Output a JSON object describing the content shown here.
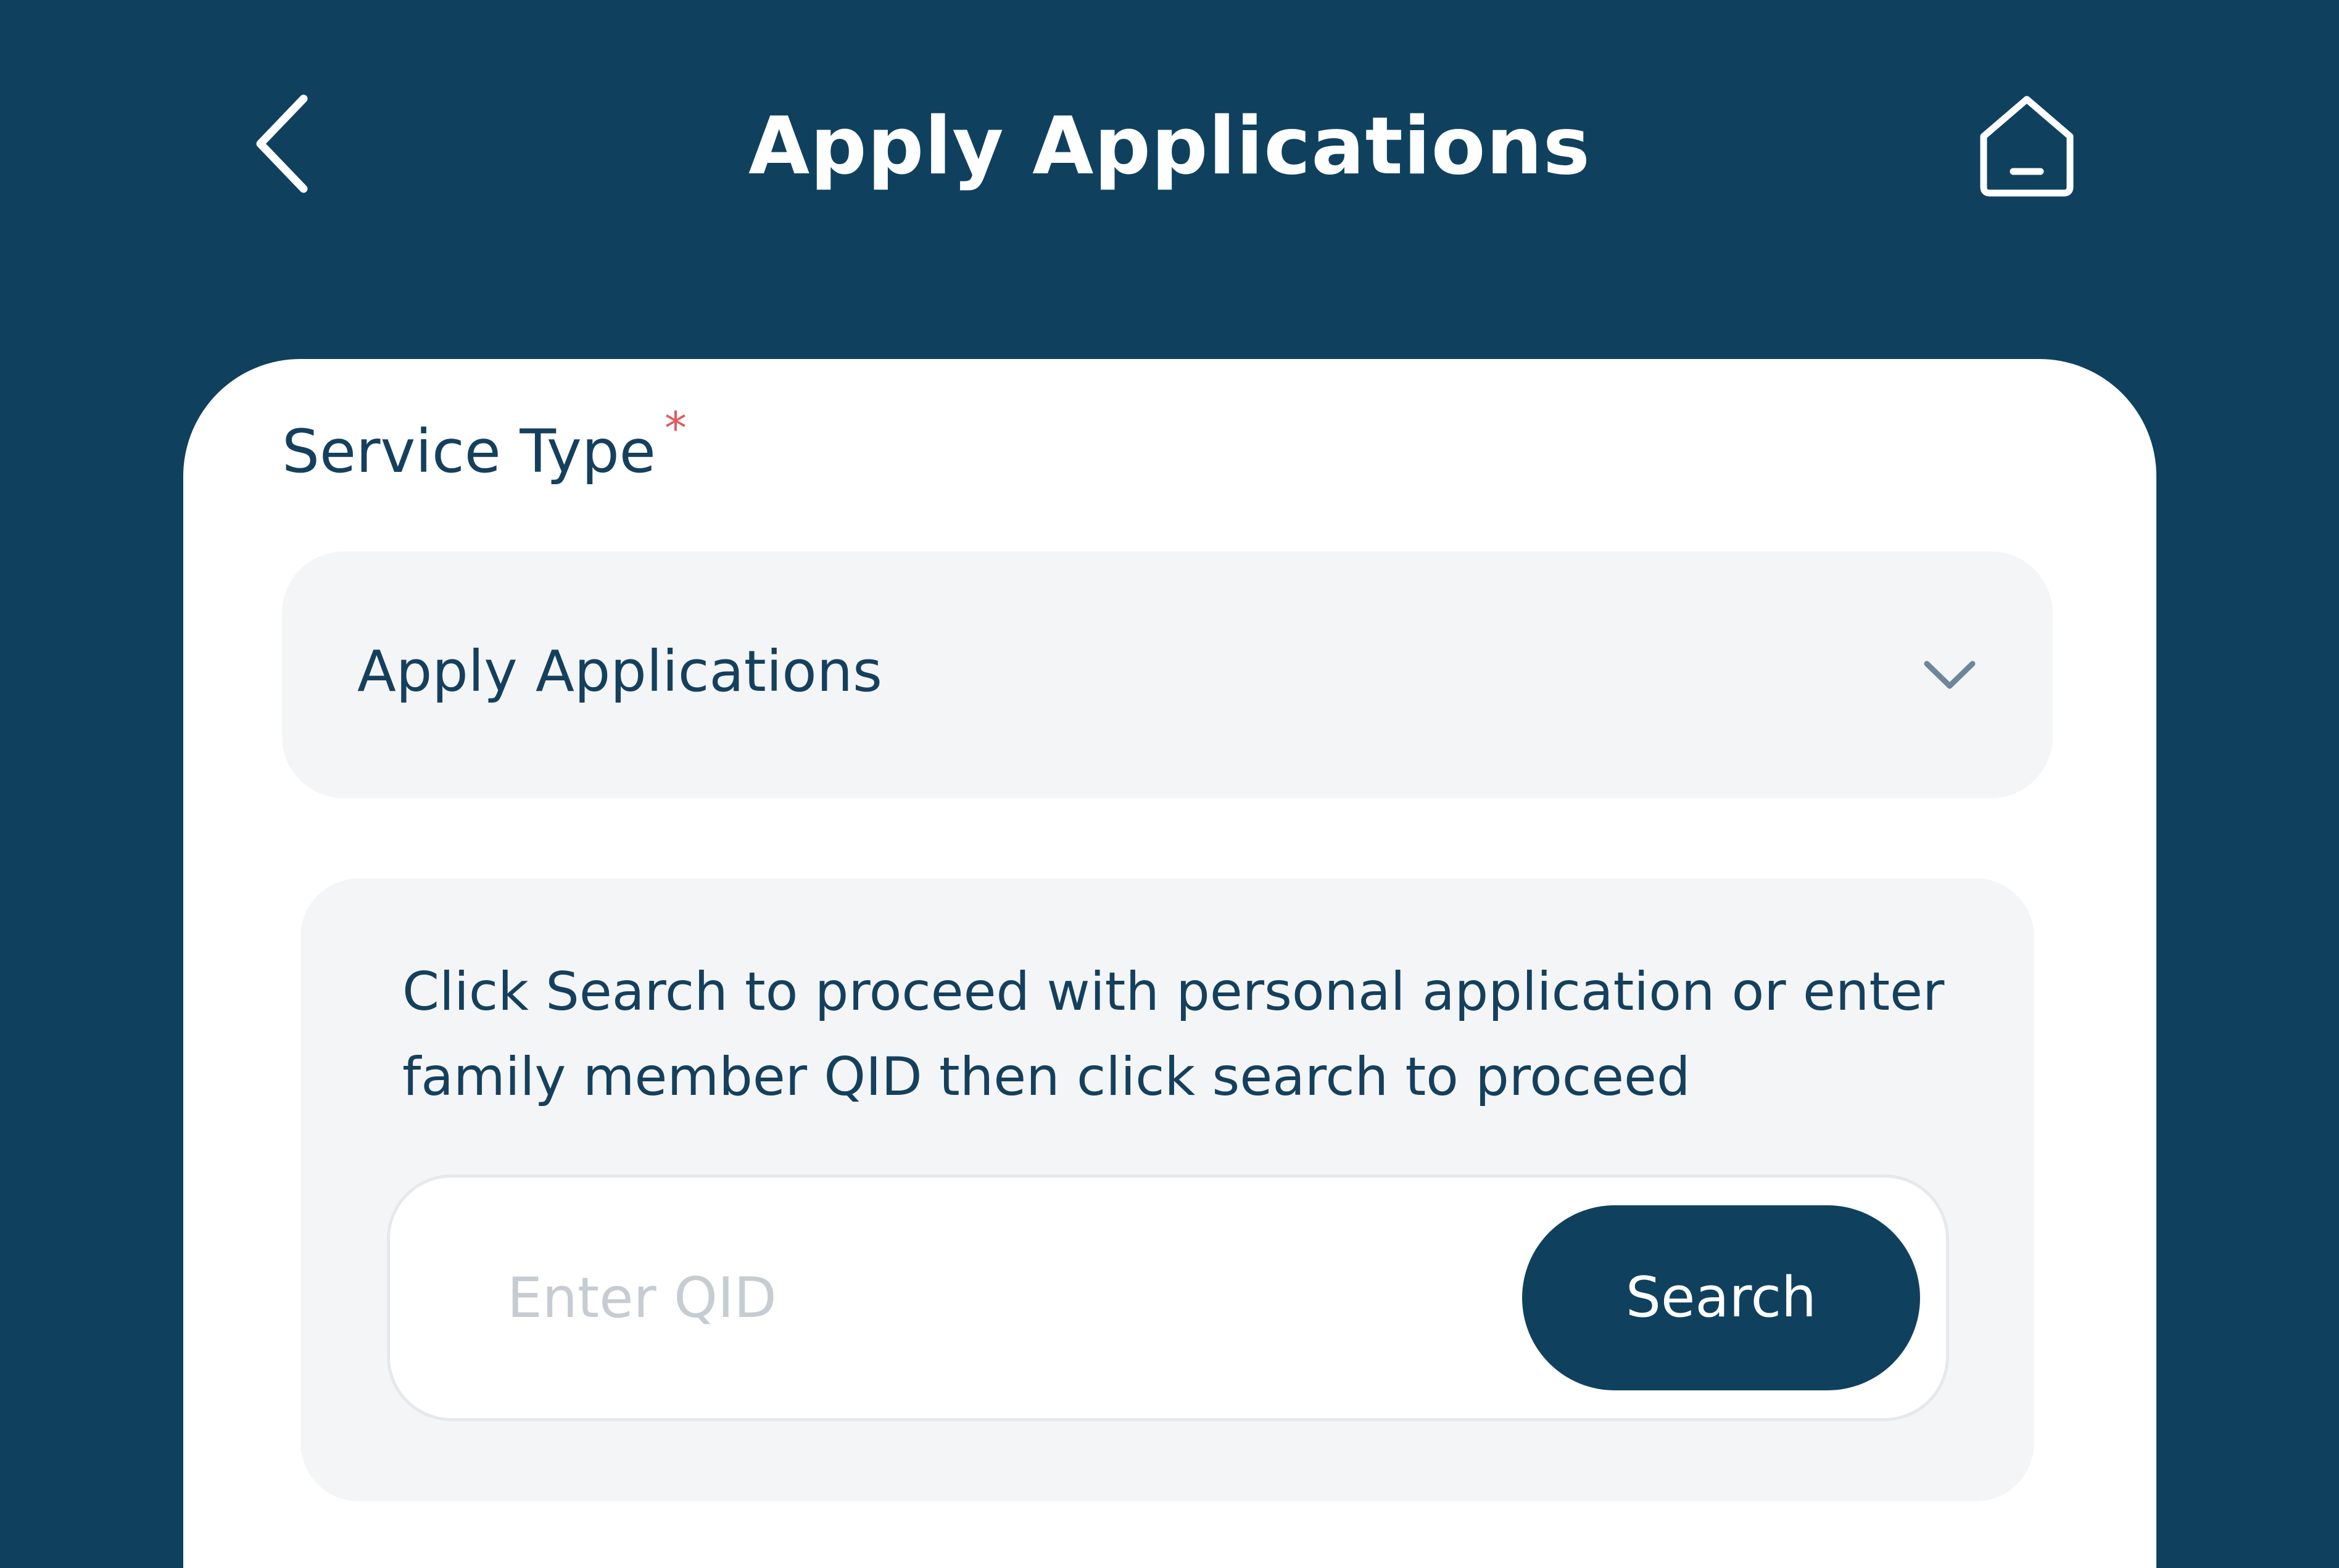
{
  "header": {
    "title": "Apply Applications",
    "back_icon": "chevron-left-icon",
    "home_icon": "home-icon"
  },
  "form": {
    "service_type_label": "Service Type",
    "required_marker": "*",
    "service_type_value": "Apply Applications",
    "dropdown_icon": "chevron-down-icon",
    "instruction_text": "Click Search to proceed with personal application or enter family member QID then click search to proceed",
    "qid_placeholder": "Enter QID",
    "qid_value": "",
    "search_label": "Search"
  },
  "colors": {
    "primary": "#0f415f",
    "text": "#15405d",
    "required": "#e05b62",
    "field_background": "#f4f5f7",
    "placeholder": "#c6ccd2"
  }
}
